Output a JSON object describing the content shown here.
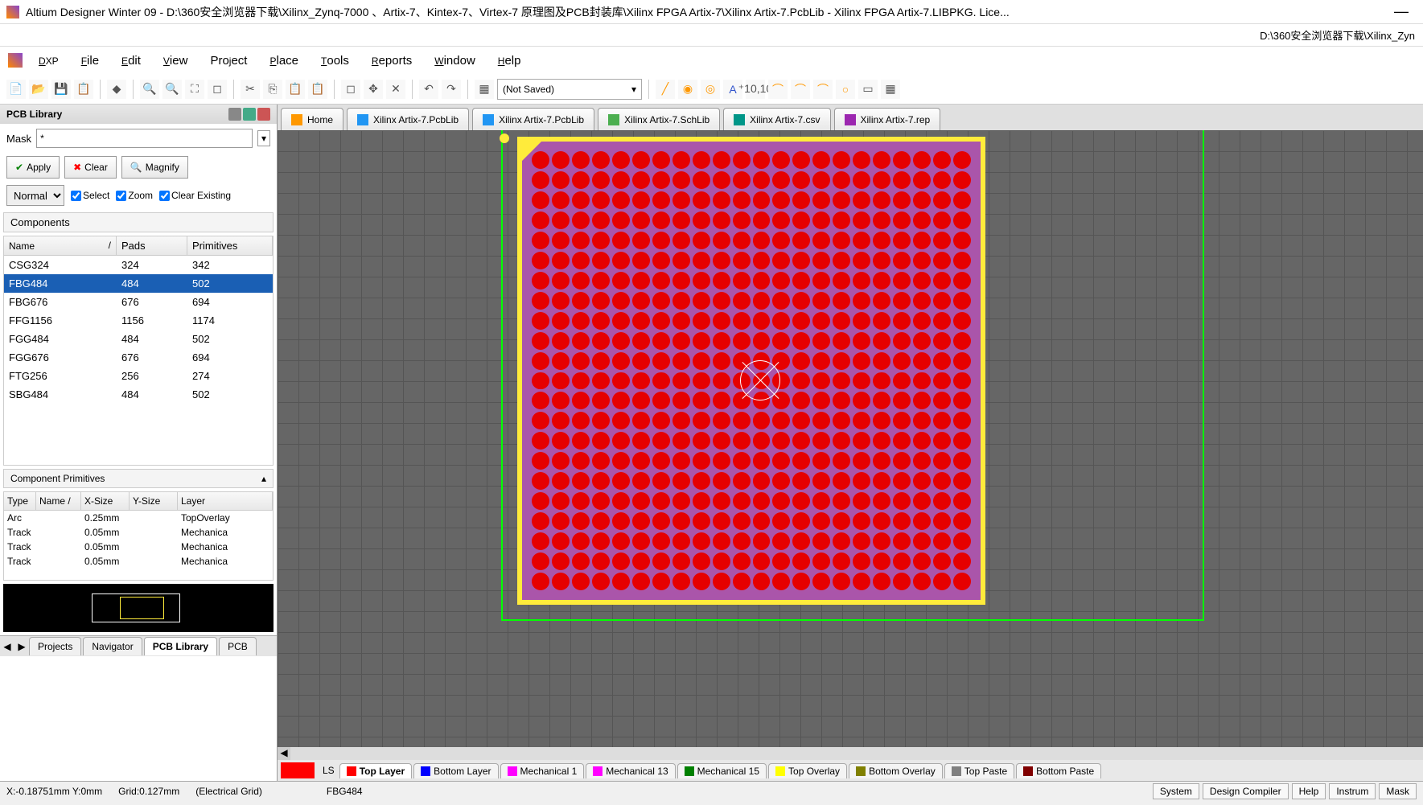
{
  "window": {
    "title": "Altium Designer Winter 09 - D:\\360安全浏览器下载\\Xilinx_Zynq-7000 、Artix-7、Kintex-7、Virtex-7 原理图及PCB封装库\\Xilinx FPGA Artix-7\\Xilinx Artix-7.PcbLib - Xilinx FPGA Artix-7.LIBPKG. Lice...",
    "path": "D:\\360安全浏览器下载\\Xilinx_Zyn"
  },
  "menu": {
    "dxp": "DXP",
    "file": "File",
    "edit": "Edit",
    "view": "View",
    "project": "Project",
    "place": "Place",
    "tools": "Tools",
    "reports": "Reports",
    "window": "Window",
    "help": "Help"
  },
  "toolbar": {
    "dropdown": "(Not Saved)"
  },
  "sidebar": {
    "title": "PCB Library",
    "mask_label": "Mask",
    "mask_value": "*",
    "apply": "Apply",
    "clear": "Clear",
    "magnify": "Magnify",
    "mode": "Normal",
    "select": "Select",
    "zoom": "Zoom",
    "clear_existing": "Clear Existing",
    "components_header": "Components",
    "columns": {
      "name": "Name",
      "pads": "Pads",
      "primitives": "Primitives"
    },
    "components": [
      {
        "name": "CSG324",
        "pads": "324",
        "primitives": "342",
        "selected": false
      },
      {
        "name": "FBG484",
        "pads": "484",
        "primitives": "502",
        "selected": true
      },
      {
        "name": "FBG676",
        "pads": "676",
        "primitives": "694",
        "selected": false
      },
      {
        "name": "FFG1156",
        "pads": "1156",
        "primitives": "1174",
        "selected": false
      },
      {
        "name": "FGG484",
        "pads": "484",
        "primitives": "502",
        "selected": false
      },
      {
        "name": "FGG676",
        "pads": "676",
        "primitives": "694",
        "selected": false
      },
      {
        "name": "FTG256",
        "pads": "256",
        "primitives": "274",
        "selected": false
      },
      {
        "name": "SBG484",
        "pads": "484",
        "primitives": "502",
        "selected": false
      }
    ],
    "primitives_header": "Component Primitives",
    "prim_columns": {
      "type": "Type",
      "name": "Name /",
      "xsize": "X-Size",
      "ysize": "Y-Size",
      "layer": "Layer"
    },
    "primitives": [
      {
        "type": "Arc",
        "name": "",
        "xsize": "0.25mm",
        "ysize": "",
        "layer": "TopOverlay"
      },
      {
        "type": "Track",
        "name": "",
        "xsize": "0.05mm",
        "ysize": "",
        "layer": "Mechanica"
      },
      {
        "type": "Track",
        "name": "",
        "xsize": "0.05mm",
        "ysize": "",
        "layer": "Mechanica"
      },
      {
        "type": "Track",
        "name": "",
        "xsize": "0.05mm",
        "ysize": "",
        "layer": "Mechanica"
      }
    ],
    "tabs": {
      "projects": "Projects",
      "navigator": "Navigator",
      "pcblib": "PCB Library",
      "pcb": "PCB"
    }
  },
  "doctabs": [
    {
      "label": "Home",
      "icon": "home"
    },
    {
      "label": "Xilinx Artix-7.PcbLib",
      "icon": "pcb"
    },
    {
      "label": "Xilinx Artix-7.PcbLib",
      "icon": "pcb"
    },
    {
      "label": "Xilinx Artix-7.SchLib",
      "icon": "sch"
    },
    {
      "label": "Xilinx Artix-7.csv",
      "icon": "csv"
    },
    {
      "label": "Xilinx Artix-7.rep",
      "icon": "rep"
    }
  ],
  "layers": {
    "ls": "LS",
    "tabs": [
      {
        "name": "Top Layer",
        "color": "#ff0000",
        "active": true
      },
      {
        "name": "Bottom Layer",
        "color": "#0000ff"
      },
      {
        "name": "Mechanical 1",
        "color": "#ff00ff"
      },
      {
        "name": "Mechanical 13",
        "color": "#ff00ff"
      },
      {
        "name": "Mechanical 15",
        "color": "#008000"
      },
      {
        "name": "Top Overlay",
        "color": "#ffff00"
      },
      {
        "name": "Bottom Overlay",
        "color": "#808000"
      },
      {
        "name": "Top Paste",
        "color": "#808080"
      },
      {
        "name": "Bottom Paste",
        "color": "#800000"
      }
    ]
  },
  "status": {
    "coords": "X:-0.18751mm Y:0mm",
    "grid": "Grid:0.127mm",
    "snap": "(Electrical Grid)",
    "component": "FBG484",
    "right": [
      "System",
      "Design Compiler",
      "Help",
      "Instrum",
      "Mask"
    ]
  }
}
